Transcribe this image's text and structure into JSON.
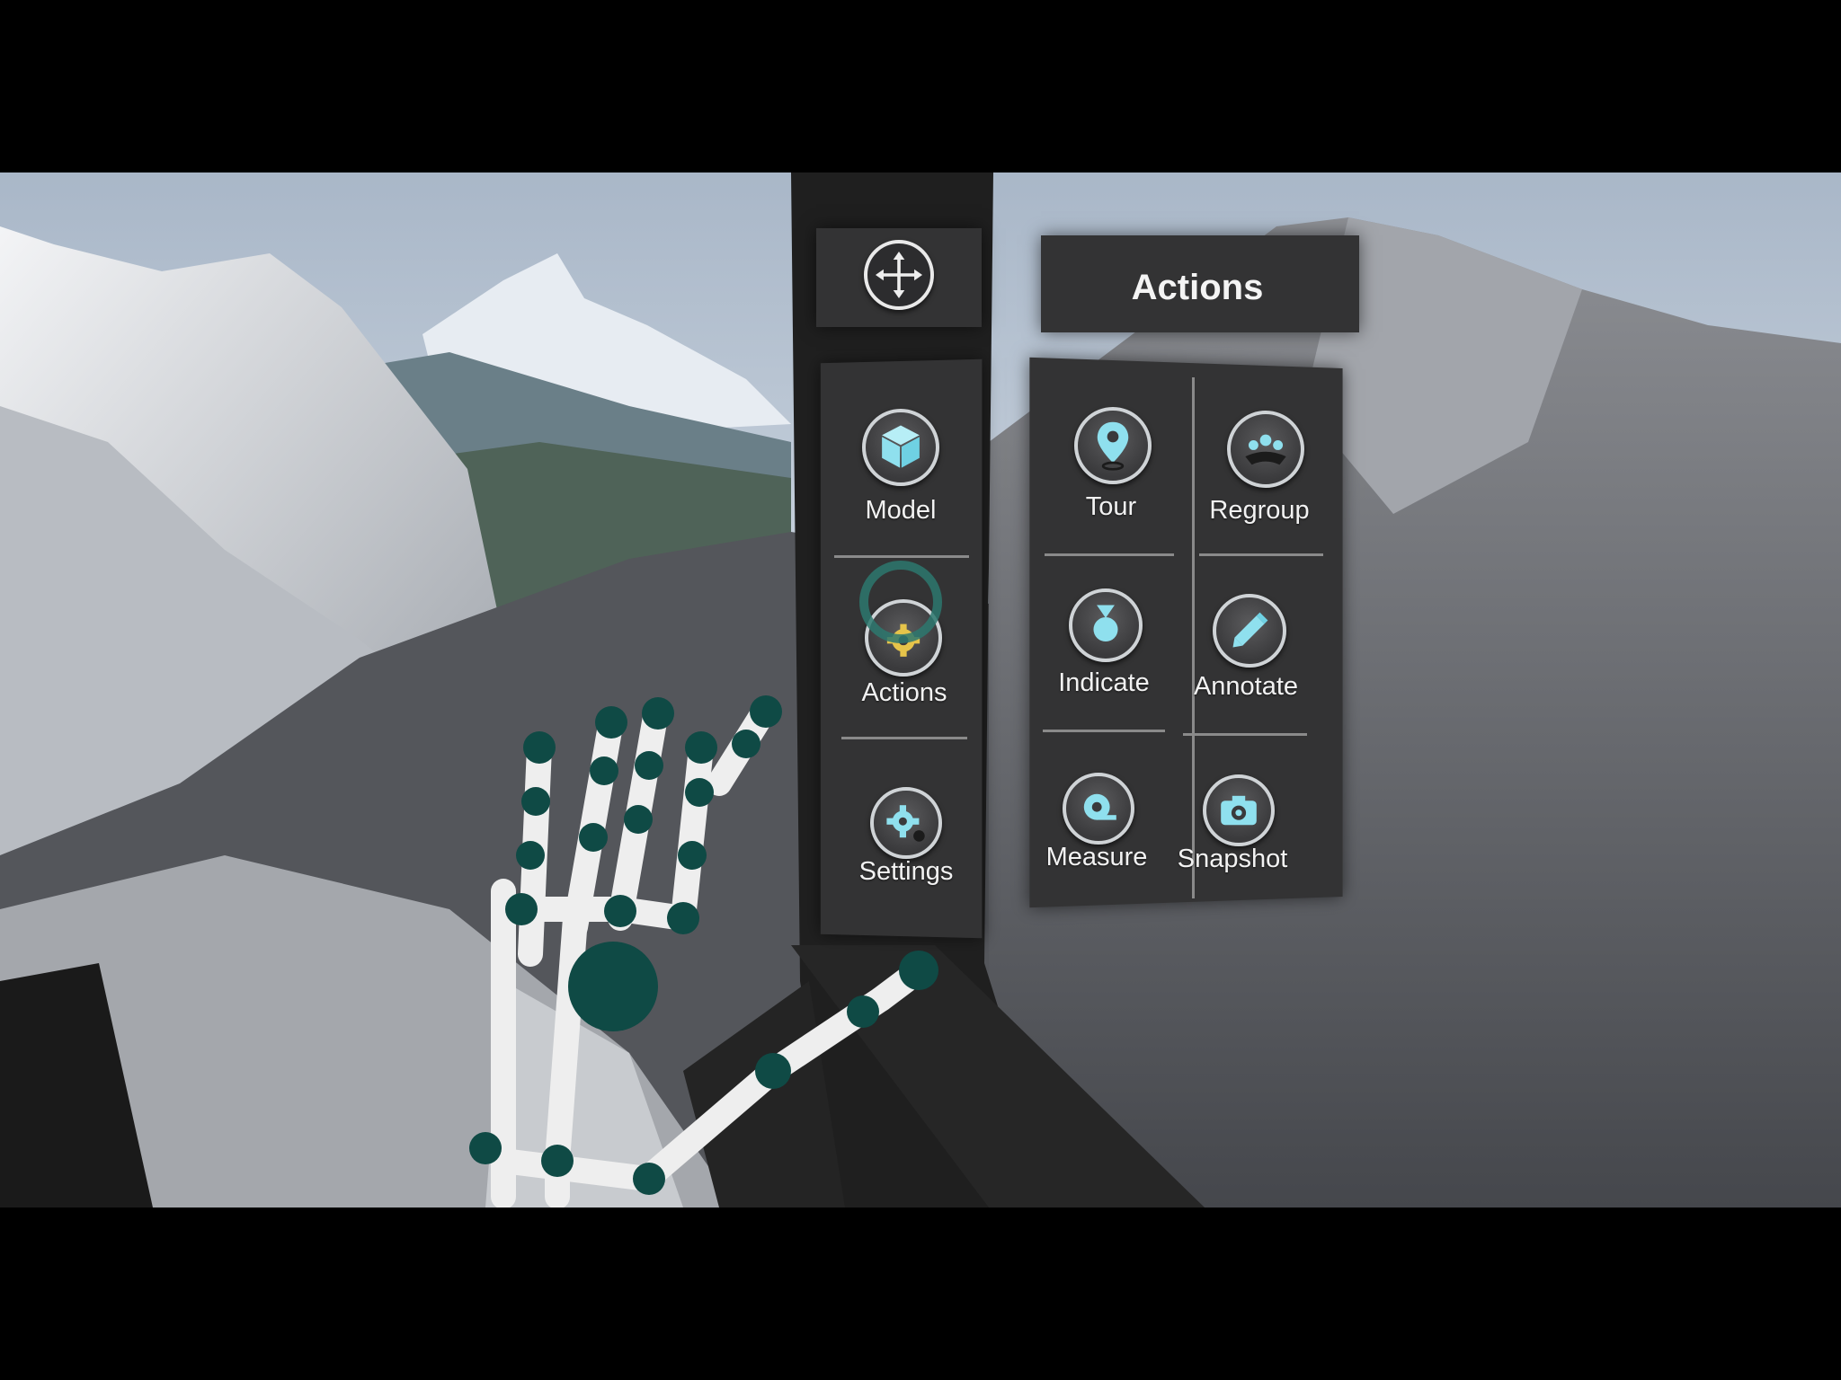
{
  "colors": {
    "panel": "#333334",
    "accent_icon": "#8fe0ee",
    "hand_joint": "#0f4a45",
    "hand_bone": "#eeeeee"
  },
  "move_handle": {
    "icon": "move-arrows-icon"
  },
  "main_menu": {
    "items": [
      {
        "label": "Model",
        "icon": "cube-icon"
      },
      {
        "label": "Actions",
        "icon": "actions-gear-icon",
        "selected": true
      },
      {
        "label": "Settings",
        "icon": "gear-icon"
      }
    ]
  },
  "actions_panel": {
    "title": "Actions",
    "items": [
      {
        "label": "Tour",
        "icon": "map-pin-icon"
      },
      {
        "label": "Regroup",
        "icon": "regroup-icon"
      },
      {
        "label": "Indicate",
        "icon": "indicate-icon"
      },
      {
        "label": "Annotate",
        "icon": "pencil-icon"
      },
      {
        "label": "Measure",
        "icon": "tape-measure-icon"
      },
      {
        "label": "Snapshot",
        "icon": "camera-icon"
      }
    ]
  }
}
